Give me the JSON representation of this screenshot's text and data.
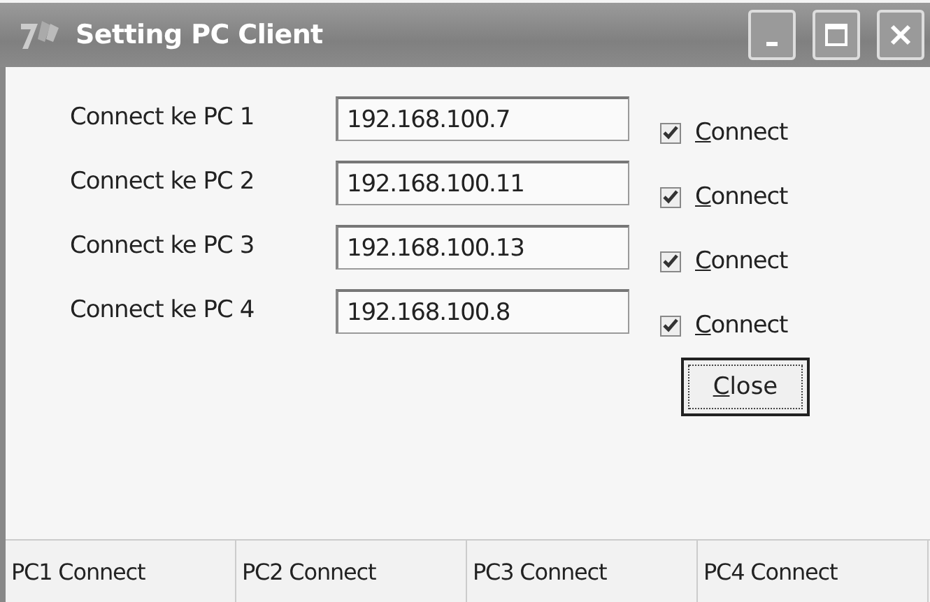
{
  "window": {
    "title": "Setting PC Client"
  },
  "connections": [
    {
      "label": "Connect ke PC 1",
      "address": "192.168.100.7",
      "checkbox": "Connect",
      "checked": true
    },
    {
      "label": "Connect ke PC 2",
      "address": "192.168.100.11",
      "checkbox": "Connect",
      "checked": true
    },
    {
      "label": "Connect ke PC 3",
      "address": "192.168.100.13",
      "checkbox": "Connect",
      "checked": true
    },
    {
      "label": "Connect ke PC 4",
      "address": "192.168.100.8",
      "checkbox": "Connect",
      "checked": true
    }
  ],
  "buttons": [
    "Close"
  ],
  "status_bar": [
    "PC1 Connect",
    "PC2 Connect",
    "PC3 Connect",
    "PC4 Connect"
  ]
}
